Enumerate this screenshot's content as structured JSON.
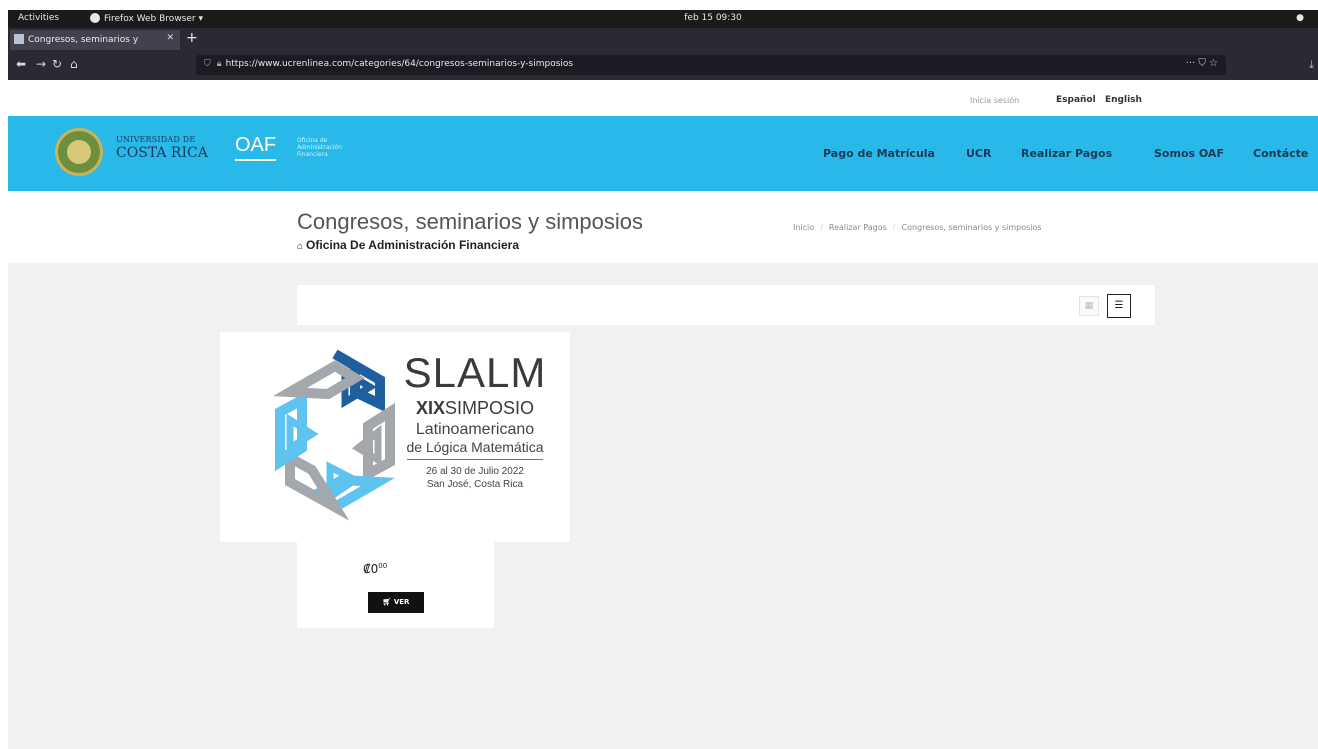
{
  "system": {
    "activities": "Activities",
    "app_name": "Firefox Web Browser",
    "clock": "feb 15  09:30"
  },
  "browser": {
    "tab_title": "Congresos, seminarios y",
    "url": "https://www.ucrenlinea.com/categories/64/congresos-seminarios-y-simposios",
    "url_actions": "··· ⛉ ☆"
  },
  "lang": {
    "login": "Inicia sesión",
    "spanish": "Español",
    "english": "English"
  },
  "header": {
    "ucr_line1": "UNIVERSIDAD DE",
    "ucr_line2": "COSTA RICA",
    "oaf": "OAF",
    "oaf_sub_1": "Oficina de",
    "oaf_sub_2": "Administración",
    "oaf_sub_3": "Financiera",
    "nav": [
      "Pago de Matrícula",
      "UCR",
      "Realizar Pagos",
      "Somos OAF",
      "Contácte"
    ]
  },
  "page": {
    "title": "Congresos, seminarios y simposios",
    "subtitle": "Oficina De Administración Financiera",
    "breadcrumb": [
      "Inicio",
      "Realizar Pagos",
      "Congresos, seminarios y simposios"
    ]
  },
  "product": {
    "logo_title": "SLALM",
    "logo_roman": "XIX",
    "logo_simposio": "SIMPOSIO",
    "logo_latino": "Latinoamericano",
    "logo_logica": "de Lógica Matemática",
    "logo_dates": "26 al 30 de Julio 2022",
    "logo_place": "San José, Costa Rica",
    "price_main": "₡0",
    "price_cents": "00",
    "button_label": "VER"
  },
  "colors": {
    "header_bg": "#29b9e8",
    "nav_text": "#1a3a5a",
    "logo_dark_blue": "#1f5fa0",
    "logo_light_blue": "#5ec3ee",
    "logo_gray": "#a4a8ad"
  }
}
